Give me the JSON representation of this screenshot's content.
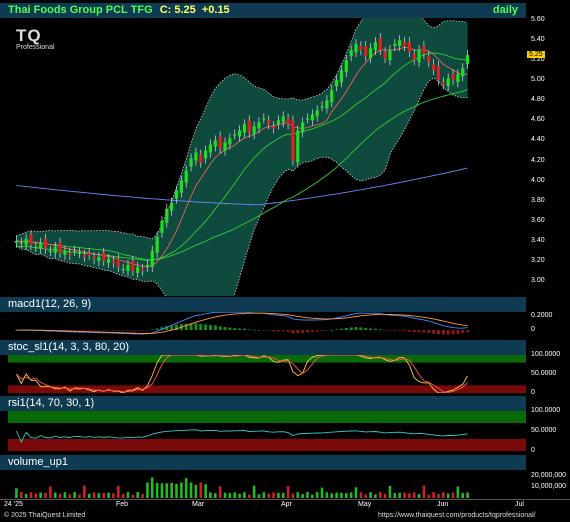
{
  "header": {
    "title": "Thai Foods Group PCL TFG",
    "close_label": "C:",
    "close_value": "5.25",
    "change": "+0.15",
    "interval": "daily",
    "logo_text": "TQ",
    "logo_sub": "Professional",
    "last_price_tag": "5.25"
  },
  "panes": {
    "macd": "macd1(12, 26, 9)",
    "stoc": "stoc_sl1(14, 3, 3, 80, 20)",
    "rsi": "rsi1(14, 70, 30, 1)",
    "volume": "volume_up1"
  },
  "x_axis": {
    "labels": [
      "24 '25",
      "Feb",
      "Mar",
      "Apr",
      "May",
      "Jun",
      "Jul"
    ]
  },
  "footer": {
    "copyright": "© 2025 ThaiQuest Limited",
    "url": "https://www.thaiquest.com/products/tqprofessional/"
  },
  "colors": {
    "up_candle": "#22dd22",
    "down_candle": "#dd2222",
    "band_fill": "#0f4a3e",
    "title_bar": "#0e3a52",
    "overbought_zone": "#0a6a0a",
    "oversold_zone": "#7a0a0a"
  },
  "chart_data": [
    {
      "type": "candlestick",
      "title": "Thai Foods Group PCL TFG",
      "y_ticks": [
        "5.60",
        "5.40",
        "5.20",
        "5.00",
        "4.80",
        "4.60",
        "4.40",
        "4.20",
        "4.00",
        "3.80",
        "3.60",
        "3.40",
        "3.20",
        "3.00"
      ],
      "ylim": [
        2.85,
        5.62
      ],
      "x_ticks": [
        "24 '25",
        "Feb",
        "Mar",
        "Apr",
        "May",
        "Jun",
        "Jul"
      ],
      "close": [
        3.4,
        3.38,
        3.42,
        3.36,
        3.34,
        3.38,
        3.32,
        3.3,
        3.34,
        3.28,
        3.3,
        3.26,
        3.3,
        3.28,
        3.24,
        3.26,
        3.22,
        3.24,
        3.2,
        3.22,
        3.18,
        3.14,
        3.12,
        3.16,
        3.1,
        3.14,
        3.1,
        3.16,
        3.3,
        3.44,
        3.6,
        3.72,
        3.78,
        3.9,
        4.0,
        4.1,
        4.22,
        4.28,
        4.18,
        4.3,
        4.36,
        4.4,
        4.32,
        4.38,
        4.42,
        4.46,
        4.5,
        4.56,
        4.48,
        4.54,
        4.58,
        4.62,
        4.56,
        4.52,
        4.6,
        4.64,
        4.56,
        4.2,
        4.5,
        4.58,
        4.62,
        4.66,
        4.7,
        4.74,
        4.8,
        4.9,
        5.0,
        5.1,
        5.2,
        5.3,
        5.36,
        5.3,
        5.24,
        5.32,
        5.38,
        5.3,
        5.22,
        5.3,
        5.36,
        5.4,
        5.34,
        5.28,
        5.2,
        5.3,
        5.26,
        5.18,
        5.1,
        5.0,
        4.96,
        5.02,
        5.0,
        5.06,
        5.12,
        5.25
      ],
      "series": [
        {
          "name": "",
          "color": "#6688ff"
        },
        {
          "name": "",
          "color": "#33cc33"
        },
        {
          "name": "",
          "color": "#33cc33"
        },
        {
          "name": "",
          "color": "#ff6666"
        }
      ]
    },
    {
      "type": "line",
      "title": "macd1(12, 26, 9)",
      "y_ticks": [
        "0.2000",
        "0"
      ],
      "ylim": [
        -0.1,
        0.26
      ]
    },
    {
      "type": "line",
      "title": "stoc_sl1(14, 3, 3, 80, 20)",
      "y_ticks": [
        "100.0000",
        "50.0000",
        "0"
      ],
      "ylim": [
        0,
        100
      ]
    },
    {
      "type": "line",
      "title": "rsi1(14, 70, 30, 1)",
      "y_ticks": [
        "100.0000",
        "50.0000",
        "0"
      ],
      "ylim": [
        0,
        100
      ]
    },
    {
      "type": "bar",
      "title": "volume_up1",
      "y_ticks": [
        "20,000,000",
        "10,000,000"
      ],
      "ylim": [
        0,
        26000000
      ]
    }
  ]
}
